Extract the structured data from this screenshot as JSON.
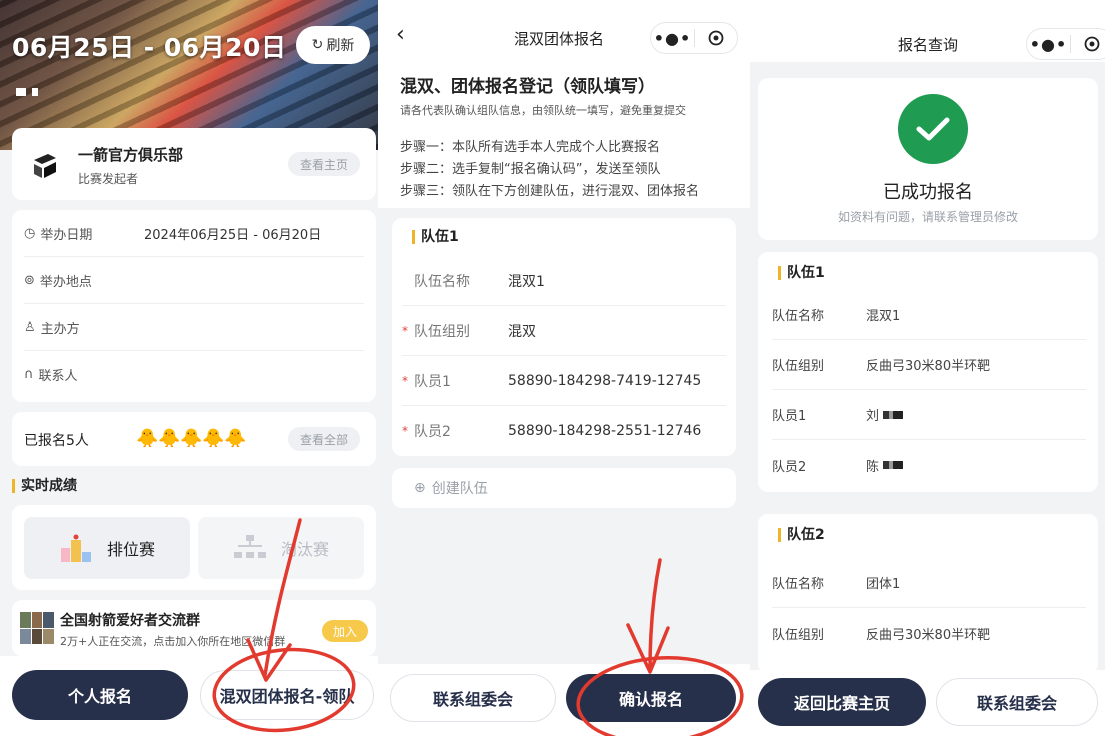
{
  "panel1": {
    "hero_date": "06月25日 - 06月20日",
    "refresh_label": "刷新",
    "club": {
      "name": "一箭官方俱乐部",
      "role": "比赛发起者",
      "view_home_label": "查看主页"
    },
    "info": [
      {
        "icon": "clock-icon",
        "label": "举办日期",
        "value": "2024年06月25日 - 06月20日"
      },
      {
        "icon": "location-icon",
        "label": "举办地点",
        "value": ""
      },
      {
        "icon": "person-icon",
        "label": "主办方",
        "value": ""
      },
      {
        "icon": "headset-icon",
        "label": "联系人",
        "value": ""
      }
    ],
    "registered_text": "已报名5人",
    "view_all_label": "查看全部",
    "realtime_title": "实时成绩",
    "tiles": [
      {
        "label": "排位赛"
      },
      {
        "label": "淘汰赛"
      }
    ],
    "group": {
      "title": "全国射箭爱好者交流群",
      "sub": "2万+人正在交流，点击加入你所在地区微信群",
      "join_label": "加入"
    },
    "btn_individual": "个人报名",
    "btn_team": "混双团体报名-领队"
  },
  "panel2": {
    "nav_title": "混双团体报名",
    "intro_title": "混双、团体报名登记（领队填写）",
    "intro_sub": "请各代表队确认组队信息，由领队统一填写，避免重复提交",
    "steps": [
      "步骤一：本队所有选手本人完成个人比赛报名",
      "步骤二：选手复制“报名确认码”，发送至领队",
      "步骤三：领队在下方创建队伍，进行混双、团体报名"
    ],
    "team_head": "队伍1",
    "rows": [
      {
        "required": false,
        "label": "队伍名称",
        "value": "混双1"
      },
      {
        "required": true,
        "label": "队伍组别",
        "value": "混双"
      },
      {
        "required": true,
        "label": "队员1",
        "value": "58890-184298-7419-12745"
      },
      {
        "required": true,
        "label": "队员2",
        "value": "58890-184298-2551-12746"
      }
    ],
    "create_label": "创建队伍",
    "btn_contact": "联系组委会",
    "btn_confirm": "确认报名"
  },
  "panel3": {
    "nav_title": "报名查询",
    "success_title": "已成功报名",
    "success_sub": "如资料有问题，请联系管理员修改",
    "team1": {
      "head": "队伍1",
      "rows": [
        {
          "label": "队伍名称",
          "value": "混双1"
        },
        {
          "label": "队伍组别",
          "value": "反曲弓30米80半环靶"
        },
        {
          "label": "队员1",
          "value": "刘"
        },
        {
          "label": "队员2",
          "value": "陈"
        }
      ]
    },
    "team2": {
      "head": "队伍2",
      "rows": [
        {
          "label": "队伍名称",
          "value": "团体1"
        },
        {
          "label": "队伍组别",
          "value": "反曲弓30米80半环靶"
        }
      ]
    },
    "btn_back": "返回比赛主页",
    "btn_contact": "联系组委会"
  },
  "colors": {
    "primary_dark": "#27304a",
    "accent_yellow": "#f0b429",
    "success_green": "#1f9b52",
    "annotation_red": "#e23a2f"
  }
}
